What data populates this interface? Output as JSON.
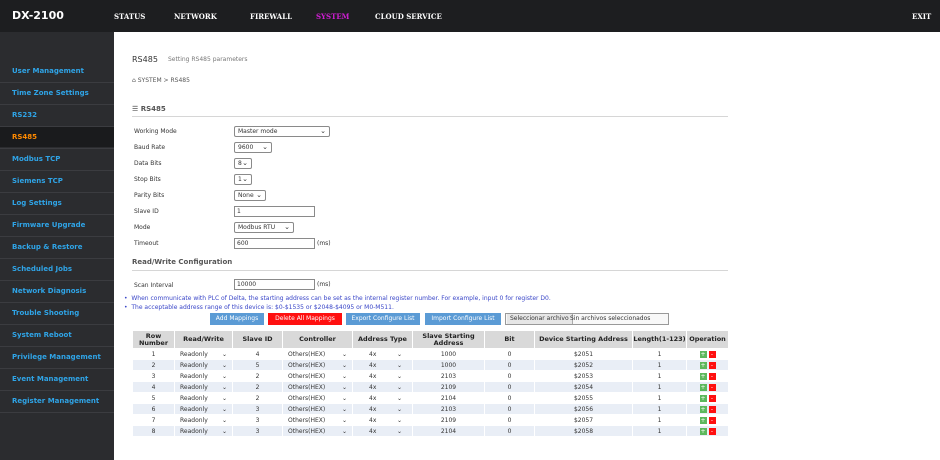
{
  "header": {
    "brand": "DX-2100",
    "nav": [
      "STATUS",
      "NETWORK",
      "FIREWALL",
      "SYSTEM",
      "CLOUD SERVICE"
    ],
    "exit": "EXIT",
    "active_color": "#d11ed4"
  },
  "sidebar": {
    "items": [
      "User Management",
      "Time Zone Settings",
      "RS232",
      "RS485",
      "Modbus TCP",
      "Siemens TCP",
      "Log Settings",
      "Firmware Upgrade",
      "Backup & Restore",
      "Scheduled Jobs",
      "Network Diagnosis",
      "Trouble Shooting",
      "System Reboot",
      "Privilege Management",
      "Event Management",
      "Register Management"
    ],
    "active": "RS485",
    "accent_color": "#2fa4e7",
    "active_color": "#ff8a00"
  },
  "page": {
    "title": "RS485",
    "subtitle": "Setting RS485 parameters",
    "breadcrumb_icon": "home-icon",
    "breadcrumb": "SYSTEM > RS485",
    "section_icon": "list-icon",
    "section_title": "RS485"
  },
  "rs485": {
    "working_mode_label": "Working Mode",
    "working_mode": "Master mode",
    "baud_rate_label": "Baud Rate",
    "baud_rate": "9600",
    "data_bits_label": "Data Bits",
    "data_bits": "8",
    "stop_bits_label": "Stop Bits",
    "stop_bits": "1",
    "parity_bits_label": "Parity Bits",
    "parity_bits": "None",
    "slave_id_label": "Slave ID",
    "slave_id": "1",
    "mode_label": "Mode",
    "mode": "Modbus RTU",
    "timeout_label": "Timeout",
    "timeout": "600",
    "timeout_unit": "(ms)"
  },
  "rw": {
    "section_title": "Read/Write Configuration",
    "scan_interval_label": "Scan Interval",
    "scan_interval": "10000",
    "scan_unit": "(ms)",
    "note1": "When communicate with PLC of Delta, the starting address can be set as the internal register number. For example, input 0 for register D0.",
    "note2": "The acceptable address range of this device is: $0-$1535 or $2048-$4095 or M0-M511.",
    "buttons": {
      "add": "Add Mappings",
      "delete_all": "Delete All Mappings",
      "export": "Export Configure List",
      "import": "Import Configure List"
    },
    "file_button": "Seleccionar archivo",
    "file_status": "Sin archivos seleccionados"
  },
  "table": {
    "headers": [
      "Row Number",
      "Read/Write",
      "Slave ID",
      "Controller",
      "Address Type",
      "Slave Starting Address",
      "Bit",
      "Device Starting Address",
      "Length(1-123)",
      "Operation"
    ],
    "rows": [
      [
        "1",
        "Readonly",
        "4",
        "Others(HEX)",
        "4x",
        "1000",
        "0",
        "$2051",
        "1"
      ],
      [
        "2",
        "Readonly",
        "5",
        "Others(HEX)",
        "4x",
        "1000",
        "0",
        "$2052",
        "1"
      ],
      [
        "3",
        "Readonly",
        "2",
        "Others(HEX)",
        "4x",
        "2103",
        "0",
        "$2053",
        "1"
      ],
      [
        "4",
        "Readonly",
        "2",
        "Others(HEX)",
        "4x",
        "2109",
        "0",
        "$2054",
        "1"
      ],
      [
        "5",
        "Readonly",
        "2",
        "Others(HEX)",
        "4x",
        "2104",
        "0",
        "$2055",
        "1"
      ],
      [
        "6",
        "Readonly",
        "3",
        "Others(HEX)",
        "4x",
        "2103",
        "0",
        "$2056",
        "1"
      ],
      [
        "7",
        "Readonly",
        "3",
        "Others(HEX)",
        "4x",
        "2109",
        "0",
        "$2057",
        "1"
      ],
      [
        "8",
        "Readonly",
        "3",
        "Others(HEX)",
        "4x",
        "2104",
        "0",
        "$2058",
        "1"
      ]
    ],
    "op_add": "+",
    "op_del": "-"
  }
}
